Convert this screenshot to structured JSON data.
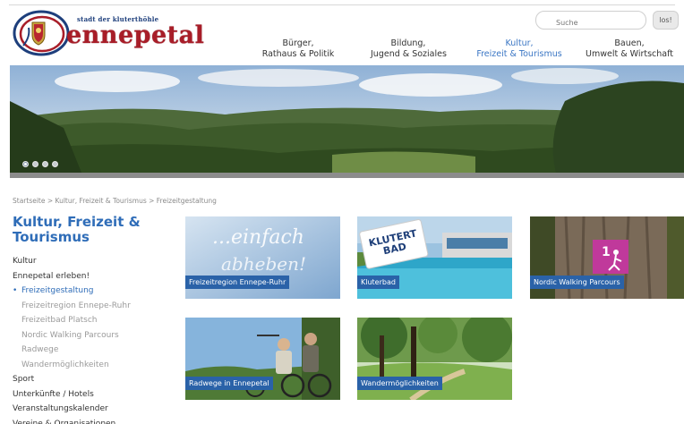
{
  "header": {
    "logo": {
      "tagline": "stadt der kluterthöhle",
      "name": "ennepetal"
    },
    "search": {
      "placeholder": "Suche",
      "button_label": "los!"
    },
    "nav": [
      {
        "line1": "Bürger,",
        "line2": "Rathaus & Politik",
        "active": false
      },
      {
        "line1": "Bildung,",
        "line2": "Jugend & Soziales",
        "active": false
      },
      {
        "line1": "Kultur,",
        "line2": "Freizeit & Tourismus",
        "active": true
      },
      {
        "line1": "Bauen,",
        "line2": "Umwelt & Wirtschaft",
        "active": false
      }
    ]
  },
  "banner": {
    "slides": 4,
    "active_slide": 1
  },
  "breadcrumb": "Startseite > Kultur, Freizeit & Tourismus > Freizeitgestaltung",
  "sidebar": {
    "title_line1": "Kultur, Freizeit &",
    "title_line2": "Tourismus",
    "items": [
      {
        "label": "Kultur",
        "level": 0
      },
      {
        "label": "Ennepetal erleben!",
        "level": 0
      },
      {
        "label": "Freizeitgestaltung",
        "level": 1,
        "current": true
      },
      {
        "label": "Freizeitregion Ennepe-Ruhr",
        "level": 2
      },
      {
        "label": "Freizeitbad Platsch",
        "level": 2
      },
      {
        "label": "Nordic Walking Parcours",
        "level": 2
      },
      {
        "label": "Radwege",
        "level": 2
      },
      {
        "label": "Wandermöglichkeiten",
        "level": 2
      },
      {
        "label": "Sport",
        "level": 0
      },
      {
        "label": "Unterkünfte / Hotels",
        "level": 0
      },
      {
        "label": "Veranstaltungskalender",
        "level": 0
      },
      {
        "label": "Vereine & Organisationen",
        "level": 0
      }
    ]
  },
  "tiles": [
    {
      "label": "Freizeitregion Ennepe-Ruhr",
      "image_text_1": "...einfach",
      "image_text_2": "abheben!"
    },
    {
      "label": "Kluterbad",
      "image_text_1": "KLUTERT",
      "image_text_2": "BAD"
    },
    {
      "label": "Nordic Walking Parcours",
      "image_text_1": "1"
    },
    {
      "label": "Radwege in Ennepetal"
    },
    {
      "label": "Wandermöglichkeiten"
    }
  ],
  "colors": {
    "accent_blue": "#2f6db8",
    "label_blue": "#2a62a8",
    "logo_red": "#a81d28"
  }
}
